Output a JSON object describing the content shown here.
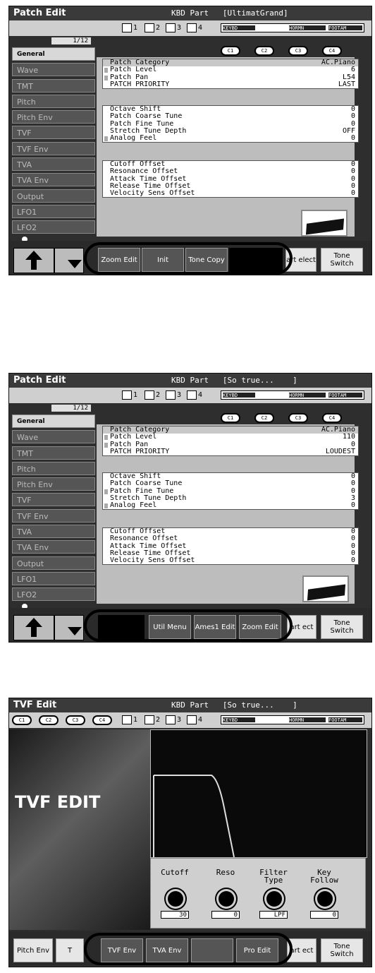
{
  "screens": [
    {
      "title": "Patch Edit",
      "part": "KBD Part   [UltimatGrand]",
      "parts": [
        "1",
        "2",
        "3",
        "4"
      ],
      "meter_labels": [
        "KEYBD",
        "HORMN",
        "FOOTAM"
      ],
      "page": "1/12",
      "knobs": [
        "C1",
        "C2",
        "C3",
        "C4"
      ],
      "tabs": [
        "General",
        "Wave",
        "TMT",
        "Pitch",
        "Pitch Env",
        "TVF",
        "TVF Env",
        "TVA",
        "TVA Env",
        "Output",
        "LFO1",
        "LFO2"
      ],
      "category": {
        "label": "Patch Category",
        "value": "AC.Piano"
      },
      "group1": [
        {
          "label": "Patch Level",
          "value": "6"
        },
        {
          "label": "Patch Pan",
          "value": "L54"
        },
        {
          "label": "PATCH PRIORITY",
          "value": "LAST"
        }
      ],
      "group2": [
        {
          "label": "Octave Shift",
          "value": "0"
        },
        {
          "label": "Patch Coarse Tune",
          "value": "0"
        },
        {
          "label": "Patch Fine Tune",
          "value": "0"
        },
        {
          "label": "Stretch Tune Depth",
          "value": "OFF"
        },
        {
          "label": "Analog Feel",
          "value": "0"
        }
      ],
      "group3": [
        {
          "label": "Cutoff Offset",
          "value": "0"
        },
        {
          "label": "Resonance Offset",
          "value": "0"
        },
        {
          "label": "Attack Time Offset",
          "value": "0"
        },
        {
          "label": "Release Time Offset",
          "value": "0"
        },
        {
          "label": "Velocity Sens Offset",
          "value": "0"
        }
      ],
      "buttons": [
        "Zoom Edit",
        "Init",
        "Tone Copy",
        ""
      ],
      "right_buttons": [
        "art elect",
        "Tone Switch"
      ]
    },
    {
      "title": "Patch Edit",
      "part": "KBD Part   [So true...    ]",
      "parts": [
        "1",
        "2",
        "3",
        "4"
      ],
      "meter_labels": [
        "KEYBD",
        "HORMN",
        "FOOTAM"
      ],
      "page": "1/12",
      "knobs": [
        "C1",
        "C2",
        "C3",
        "C4"
      ],
      "tabs": [
        "General",
        "Wave",
        "TMT",
        "Pitch",
        "Pitch Env",
        "TVF",
        "TVF Env",
        "TVA",
        "TVA Env",
        "Output",
        "LFO1",
        "LFO2"
      ],
      "category": {
        "label": "Patch Category",
        "value": "AC.Piano"
      },
      "group1": [
        {
          "label": "Patch Level",
          "value": "110"
        },
        {
          "label": "Patch Pan",
          "value": "0"
        },
        {
          "label": "PATCH PRIORITY",
          "value": "LOUDEST"
        }
      ],
      "group2": [
        {
          "label": "Octave Shift",
          "value": "0"
        },
        {
          "label": "Patch Coarse Tune",
          "value": "0"
        },
        {
          "label": "Patch Fine Tune",
          "value": "0"
        },
        {
          "label": "Stretch Tune Depth",
          "value": "3"
        },
        {
          "label": "Analog Feel",
          "value": "0"
        }
      ],
      "group3": [
        {
          "label": "Cutoff Offset",
          "value": "0"
        },
        {
          "label": "Resonance Offset",
          "value": "0"
        },
        {
          "label": "Attack Time Offset",
          "value": "0"
        },
        {
          "label": "Release Time Offset",
          "value": "0"
        },
        {
          "label": "Velocity Sens Offset",
          "value": "0"
        }
      ],
      "buttons": [
        "",
        "Util Menu",
        "Ames1 Edit",
        "Zoom Edit"
      ],
      "right_buttons": [
        "art ect",
        "Tone Switch"
      ]
    },
    {
      "title": "TVF Edit",
      "part": "KBD Part   [So true...    ]",
      "knobs": [
        "C1",
        "C2",
        "C3",
        "C4"
      ],
      "parts": [
        "1",
        "2",
        "3",
        "4"
      ],
      "meter_labels": [
        "KEYBD",
        "HORMN",
        "FOOTAM"
      ],
      "art_label": "TVF EDIT",
      "params": [
        {
          "label": "Cutoff",
          "value": "30"
        },
        {
          "label": "Reso",
          "value": "0"
        },
        {
          "label": "Filter Type",
          "value": "LPF"
        },
        {
          "label": "Key Follow",
          "value": "0"
        }
      ],
      "left_buttons": [
        "Pitch Env",
        "T"
      ],
      "buttons": [
        "TVF Env",
        "TVA Env",
        "",
        "Pro Edit"
      ],
      "right_buttons": [
        "art ect",
        "Tone Switch"
      ]
    }
  ]
}
